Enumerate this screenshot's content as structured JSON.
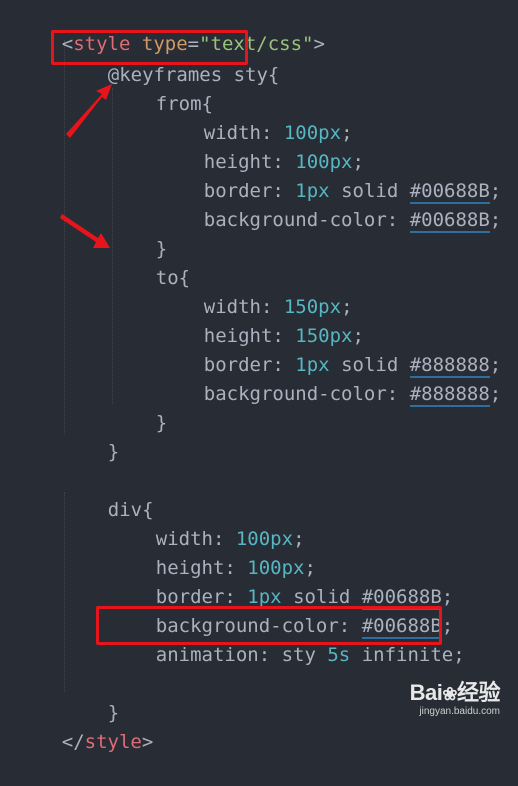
{
  "code": {
    "line1": {
      "open": "<",
      "tag": "style",
      "attr": "type",
      "eq": "=",
      "str": "\"text/css\"",
      "close": ">"
    },
    "line2": {
      "text": "@keyframes sty{"
    },
    "line3": {
      "text": "from{"
    },
    "line4": {
      "prop": "width:",
      "num": "100px",
      "semi": ";"
    },
    "line5": {
      "prop": "height:",
      "num": "100px",
      "semi": ";"
    },
    "line6": {
      "prop": "border:",
      "num": "1px",
      "mid": " solid ",
      "hex": "#00688B",
      "semi": ";"
    },
    "line7": {
      "prop": "background-color:",
      "hex": "#00688B",
      "semi": ";"
    },
    "line8": {
      "text": "}"
    },
    "line9": {
      "text": "to{"
    },
    "line10": {
      "prop": "width:",
      "num": "150px",
      "semi": ";"
    },
    "line11": {
      "prop": "height:",
      "num": "150px",
      "semi": ";"
    },
    "line12": {
      "prop": "border:",
      "num": "1px",
      "mid": " solid ",
      "hex": "#888888",
      "semi": ";"
    },
    "line13": {
      "prop": "background-color:",
      "hex": "#888888",
      "semi": ";"
    },
    "line14": {
      "text": "}"
    },
    "line15": {
      "text": "}"
    },
    "line17": {
      "text": "div{"
    },
    "line18": {
      "prop": "width:",
      "num": "100px",
      "semi": ";"
    },
    "line19": {
      "prop": "height:",
      "num": "100px",
      "semi": ";"
    },
    "line20": {
      "prop": "border:",
      "num": "1px",
      "mid": " solid ",
      "hex": "#00688B",
      "semi": ";"
    },
    "line21": {
      "prop": "background-color:",
      "hex": "#00688B",
      "semi": ";"
    },
    "line22": {
      "pre": "animation: sty ",
      "num": "5s",
      "post": " infinite;"
    },
    "line24": {
      "text": "}"
    },
    "line25": {
      "open": "</",
      "tag": "style",
      "close": ">"
    }
  },
  "watermark": {
    "logo": "Bai",
    "logo_tail": "经验",
    "url": "jingyan.baidu.com"
  },
  "colors": {
    "background": "#282c34",
    "highlight": "#e8141b",
    "tag": "#e06c75",
    "attr": "#d19a66",
    "string": "#98c379",
    "number": "#56b6c2"
  },
  "icons": [
    "paw-icon",
    "arrow-icon"
  ]
}
